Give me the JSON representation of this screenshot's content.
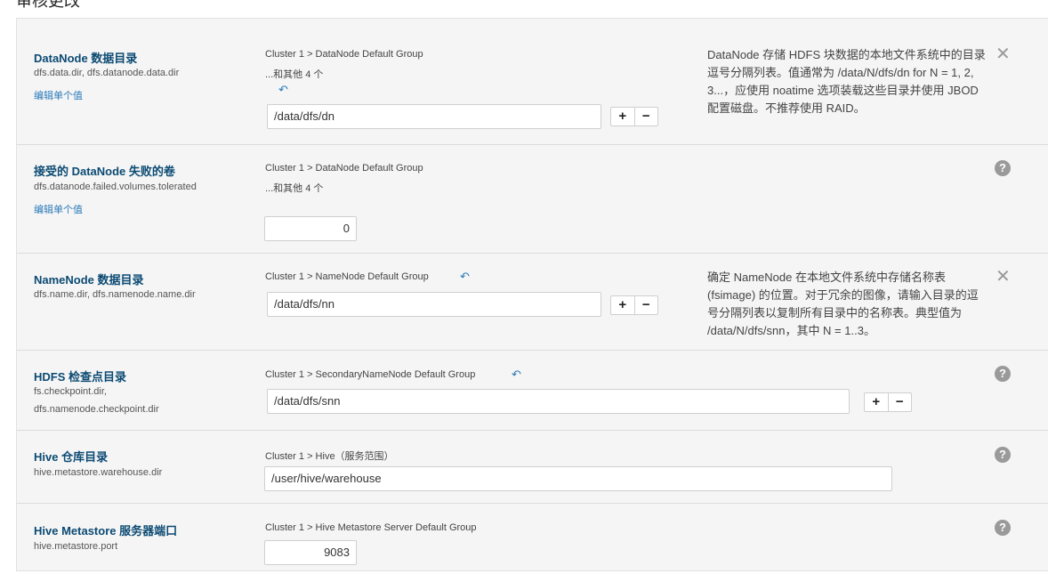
{
  "page_title": "审核更改",
  "rows": [
    {
      "name": "DataNode 数据目录",
      "key": "dfs.data.dir, dfs.datanode.data.dir",
      "edit_link": "编辑单个值",
      "scope": "Cluster 1 > DataNode Default Group",
      "others": "...和其他 4 个",
      "value": "/data/dfs/dn",
      "description": "DataNode 存储 HDFS 块数据的本地文件系统中的目录逗号分隔列表。值通常为 /data/N/dfs/dn for N = 1, 2, 3...，应使用 noatime 选项装载这些目录并使用 JBOD 配置磁盘。不推荐使用 RAID。"
    },
    {
      "name": "接受的 DataNode 失败的卷",
      "key": "dfs.datanode.failed.volumes.tolerated",
      "edit_link": "编辑单个值",
      "scope": "Cluster 1 > DataNode Default Group",
      "others": "...和其他 4 个",
      "value": "0"
    },
    {
      "name": "NameNode 数据目录",
      "key": "dfs.name.dir, dfs.namenode.name.dir",
      "scope": "Cluster 1 > NameNode Default Group",
      "value": "/data/dfs/nn",
      "description": "确定 NameNode 在本地文件系统中存储名称表 (fsimage) 的位置。对于冗余的图像，请输入目录的逗号分隔列表以复制所有目录中的名称表。典型值为 /data/N/dfs/snn，其中 N = 1..3。"
    },
    {
      "name": "HDFS 检查点目录",
      "key": "fs.checkpoint.dir, dfs.namenode.checkpoint.dir",
      "scope": "Cluster 1 > SecondaryNameNode Default Group",
      "value": "/data/dfs/snn"
    },
    {
      "name": "Hive 仓库目录",
      "key": "hive.metastore.warehouse.dir",
      "scope": "Cluster 1 > Hive（服务范围）",
      "value": "/user/hive/warehouse"
    },
    {
      "name": "Hive Metastore 服务器端口",
      "key": "hive.metastore.port",
      "scope": "Cluster 1 > Hive Metastore Server Default Group",
      "value": "9083"
    }
  ],
  "icons": {
    "undo": "↶",
    "plus": "+",
    "minus": "−",
    "close": "✕",
    "help": "?"
  },
  "colors": {
    "name": "#0b4a73",
    "link": "#2a7ab9",
    "panel_bg": "#f5f5f5"
  }
}
